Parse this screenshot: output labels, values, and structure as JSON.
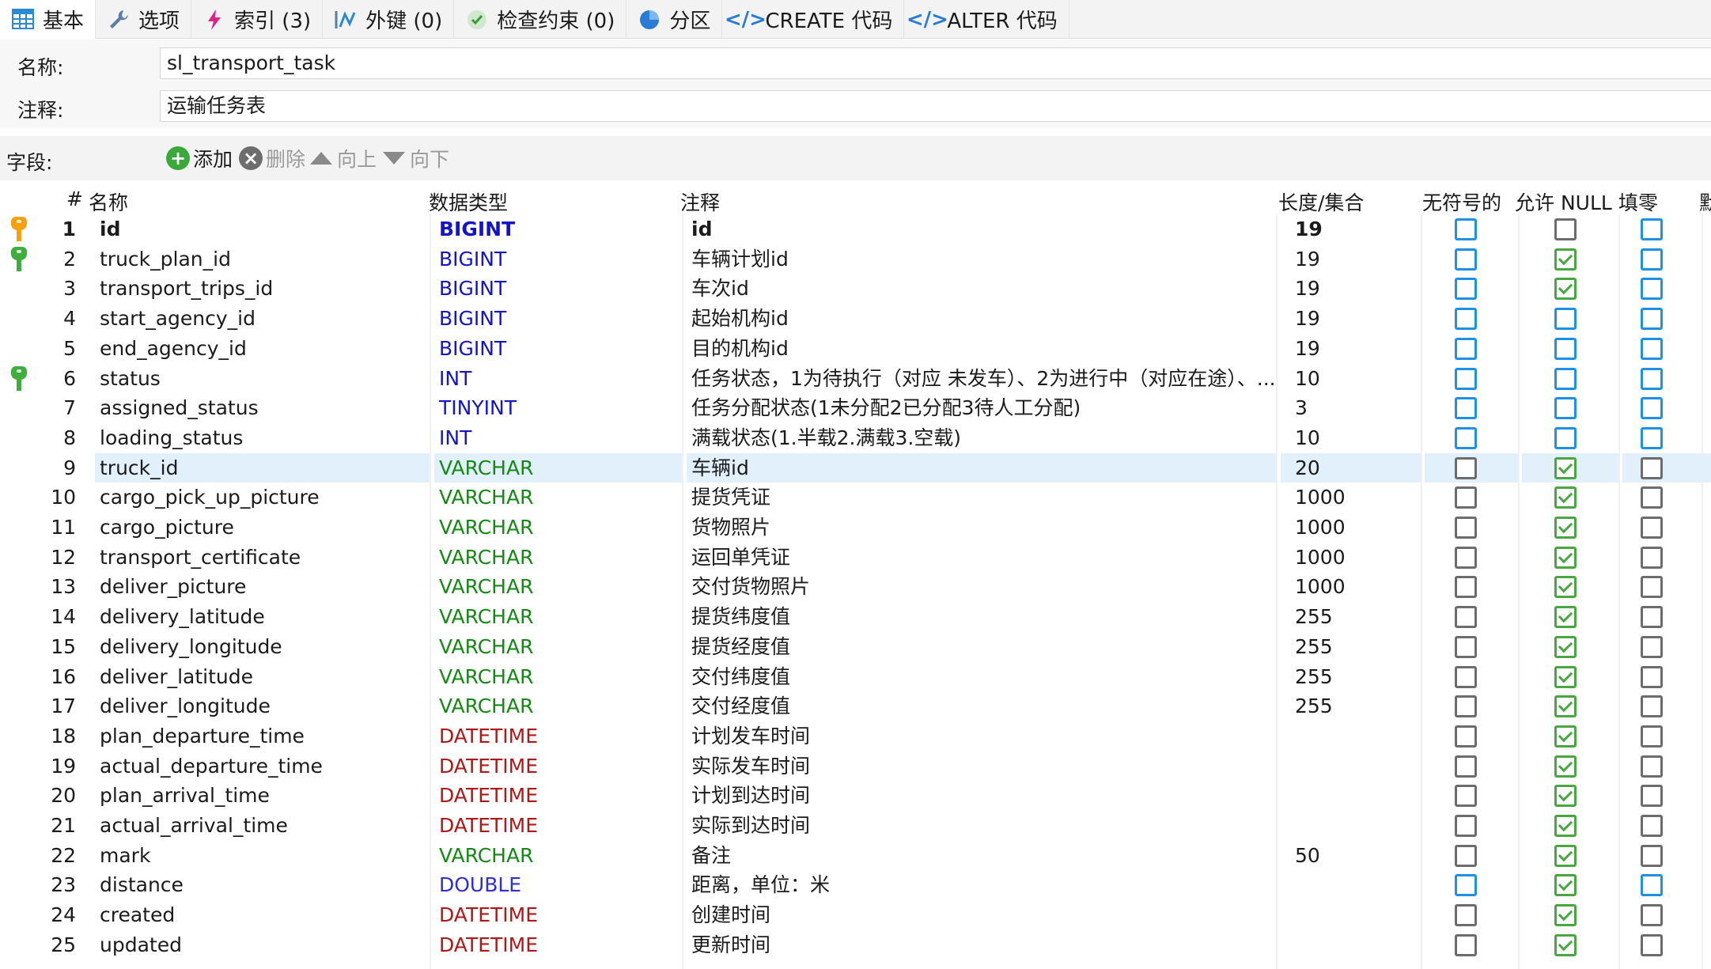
{
  "tabs": [
    {
      "label": "基本",
      "icon": "table-icon",
      "active": true
    },
    {
      "label": "选项",
      "icon": "wrench-icon"
    },
    {
      "label": "索引 (3)",
      "icon": "lightning-icon"
    },
    {
      "label": "外键 (0)",
      "icon": "foreign-key-icon"
    },
    {
      "label": "检查约束 (0)",
      "icon": "check-circle-icon"
    },
    {
      "label": "分区",
      "icon": "pie-icon"
    },
    {
      "label": "CREATE 代码",
      "icon": "code-icon"
    },
    {
      "label": "ALTER 代码",
      "icon": "code-icon"
    }
  ],
  "form": {
    "name_label": "名称:",
    "name_value": "sl_transport_task",
    "comment_label": "注释:",
    "comment_value": "运输任务表"
  },
  "fieldbar": {
    "label": "字段:",
    "add": "添加",
    "delete": "删除",
    "up": "向上",
    "down": "向下"
  },
  "headers": {
    "num": "#",
    "name": "名称",
    "type": "数据类型",
    "comment": "注释",
    "length": "长度/集合",
    "unsigned": "无符号的",
    "nullable": "允许 NULL",
    "zerofill": "填零",
    "default": "默"
  },
  "colors": {
    "type_bigint": "#1414c8",
    "type_varchar": "#148a14",
    "type_datetime": "#b01818",
    "accent_blue": "#1e90e8",
    "check_green": "#49a640"
  },
  "rows": [
    {
      "num": "1",
      "name": "id",
      "type": "BIGINT",
      "comment": "id",
      "length": "19",
      "key": "primary",
      "bold": true,
      "unsigned": "blue",
      "nullable": "gray",
      "zerofill": "blue"
    },
    {
      "num": "2",
      "name": "truck_plan_id",
      "type": "BIGINT",
      "comment": "车辆计划id",
      "length": "19",
      "key": "index",
      "unsigned": "blue",
      "nullable": "check",
      "zerofill": "blue"
    },
    {
      "num": "3",
      "name": "transport_trips_id",
      "type": "BIGINT",
      "comment": "车次id",
      "length": "19",
      "unsigned": "blue",
      "nullable": "check",
      "zerofill": "blue"
    },
    {
      "num": "4",
      "name": "start_agency_id",
      "type": "BIGINT",
      "comment": "起始机构id",
      "length": "19",
      "unsigned": "blue",
      "nullable": "blue",
      "zerofill": "blue"
    },
    {
      "num": "5",
      "name": "end_agency_id",
      "type": "BIGINT",
      "comment": "目的机构id",
      "length": "19",
      "unsigned": "blue",
      "nullable": "blue",
      "zerofill": "blue"
    },
    {
      "num": "6",
      "name": "status",
      "type": "INT",
      "comment": "任务状态，1为待执行（对应 未发车）、2为进行中（对应在途）、...",
      "length": "10",
      "key": "index",
      "unsigned": "blue",
      "nullable": "blue",
      "zerofill": "blue"
    },
    {
      "num": "7",
      "name": "assigned_status",
      "type": "TINYINT",
      "comment": "任务分配状态(1未分配2已分配3待人工分配)",
      "length": "3",
      "unsigned": "blue",
      "nullable": "blue",
      "zerofill": "blue"
    },
    {
      "num": "8",
      "name": "loading_status",
      "type": "INT",
      "comment": "满载状态(1.半载2.满载3.空载)",
      "length": "10",
      "unsigned": "blue",
      "nullable": "blue",
      "zerofill": "blue"
    },
    {
      "num": "9",
      "name": "truck_id",
      "type": "VARCHAR",
      "comment": "车辆id",
      "length": "20",
      "selected": true,
      "unsigned": "gray",
      "nullable": "check",
      "zerofill": "gray"
    },
    {
      "num": "10",
      "name": "cargo_pick_up_picture",
      "type": "VARCHAR",
      "comment": "提货凭证",
      "length": "1000",
      "unsigned": "gray",
      "nullable": "check",
      "zerofill": "gray"
    },
    {
      "num": "11",
      "name": "cargo_picture",
      "type": "VARCHAR",
      "comment": "货物照片",
      "length": "1000",
      "unsigned": "gray",
      "nullable": "check",
      "zerofill": "gray"
    },
    {
      "num": "12",
      "name": "transport_certificate",
      "type": "VARCHAR",
      "comment": "运回单凭证",
      "length": "1000",
      "unsigned": "gray",
      "nullable": "check",
      "zerofill": "gray"
    },
    {
      "num": "13",
      "name": "deliver_picture",
      "type": "VARCHAR",
      "comment": "交付货物照片",
      "length": "1000",
      "unsigned": "gray",
      "nullable": "check",
      "zerofill": "gray"
    },
    {
      "num": "14",
      "name": "delivery_latitude",
      "type": "VARCHAR",
      "comment": "提货纬度值",
      "length": "255",
      "unsigned": "gray",
      "nullable": "check",
      "zerofill": "gray"
    },
    {
      "num": "15",
      "name": "delivery_longitude",
      "type": "VARCHAR",
      "comment": "提货经度值",
      "length": "255",
      "unsigned": "gray",
      "nullable": "check",
      "zerofill": "gray"
    },
    {
      "num": "16",
      "name": "deliver_latitude",
      "type": "VARCHAR",
      "comment": "交付纬度值",
      "length": "255",
      "unsigned": "gray",
      "nullable": "check",
      "zerofill": "gray"
    },
    {
      "num": "17",
      "name": "deliver_longitude",
      "type": "VARCHAR",
      "comment": "交付经度值",
      "length": "255",
      "unsigned": "gray",
      "nullable": "check",
      "zerofill": "gray"
    },
    {
      "num": "18",
      "name": "plan_departure_time",
      "type": "DATETIME",
      "comment": "计划发车时间",
      "length": "",
      "unsigned": "gray",
      "nullable": "check",
      "zerofill": "gray"
    },
    {
      "num": "19",
      "name": "actual_departure_time",
      "type": "DATETIME",
      "comment": "实际发车时间",
      "length": "",
      "unsigned": "gray",
      "nullable": "check",
      "zerofill": "gray"
    },
    {
      "num": "20",
      "name": "plan_arrival_time",
      "type": "DATETIME",
      "comment": "计划到达时间",
      "length": "",
      "unsigned": "gray",
      "nullable": "check",
      "zerofill": "gray"
    },
    {
      "num": "21",
      "name": "actual_arrival_time",
      "type": "DATETIME",
      "comment": "实际到达时间",
      "length": "",
      "unsigned": "gray",
      "nullable": "check",
      "zerofill": "gray"
    },
    {
      "num": "22",
      "name": "mark",
      "type": "VARCHAR",
      "comment": "备注",
      "length": "50",
      "unsigned": "gray",
      "nullable": "check",
      "zerofill": "gray"
    },
    {
      "num": "23",
      "name": "distance",
      "type": "DOUBLE",
      "comment": "距离，单位：米",
      "length": "",
      "unsigned": "blue",
      "nullable": "check",
      "zerofill": "blue"
    },
    {
      "num": "24",
      "name": "created",
      "type": "DATETIME",
      "comment": "创建时间",
      "length": "",
      "unsigned": "gray",
      "nullable": "check",
      "zerofill": "gray"
    },
    {
      "num": "25",
      "name": "updated",
      "type": "DATETIME",
      "comment": "更新时间",
      "length": "",
      "unsigned": "gray",
      "nullable": "check",
      "zerofill": "gray"
    }
  ]
}
